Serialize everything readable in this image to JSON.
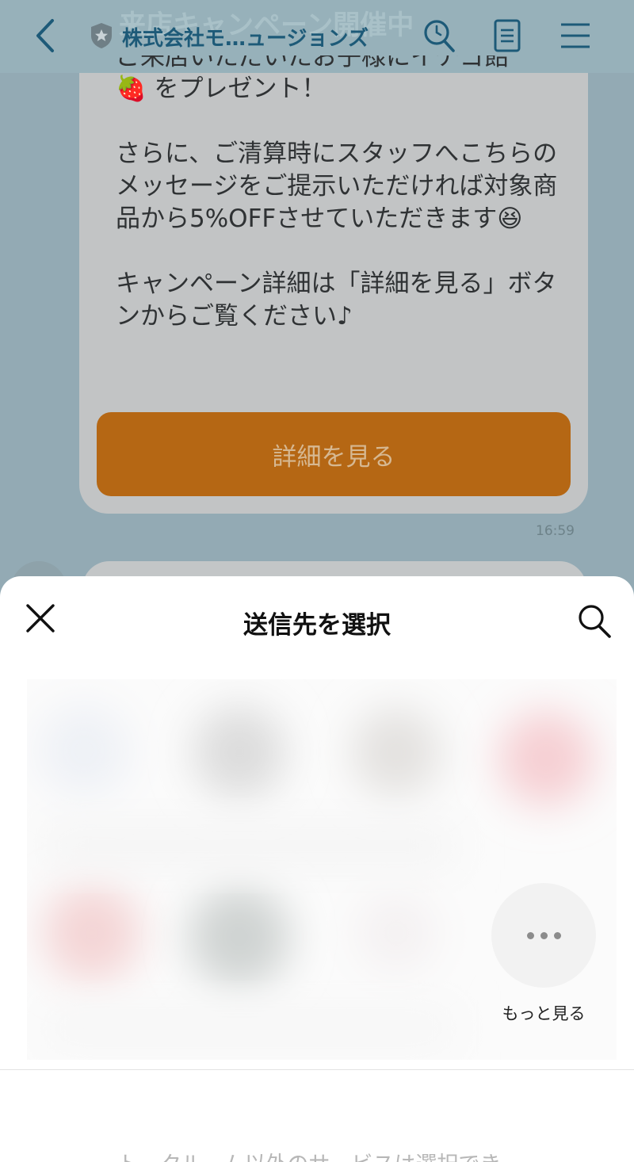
{
  "header": {
    "ghost_title": "来店キャンペーン開催中",
    "title": "株式会社モ…ュージョンズ"
  },
  "message": {
    "cut_line": "ご来店いただいたお子様にイチゴ飴",
    "body": "🍓 をプレゼント！\n\nさらに、ご清算時にスタッフへこちらのメッセージをご提示いただければ対象商品から5%OFFさせていただきます😆\n\nキャンペーン詳細は「詳細を見る」ボタンからご覧ください♪",
    "button_label": "詳細を見る",
    "time": "16:59"
  },
  "sheet": {
    "title": "送信先を選択",
    "more_label": "もっと見る",
    "footer_note": "トークルーム以外のサービスは選択でき"
  },
  "colors": {
    "accent": "#b56714",
    "header_text": "#1d5a78"
  },
  "icons": [
    "back-icon",
    "shield-star-icon",
    "search-icon",
    "note-icon",
    "menu-icon",
    "close-icon",
    "more-dots-icon"
  ]
}
